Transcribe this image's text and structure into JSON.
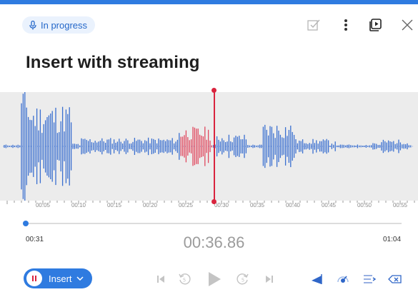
{
  "header": {
    "status_label": "In progress",
    "title": "Insert with streaming",
    "icons": [
      "mic-icon",
      "check-square-icon",
      "more-vertical-icon",
      "play-window-icon",
      "close-icon"
    ]
  },
  "timeline": {
    "tick_labels": [
      "00:05",
      "00:10",
      "00:15",
      "00:20",
      "00:25",
      "00:30",
      "00:35",
      "00:40",
      "00:45",
      "00:50",
      "00:55"
    ],
    "start_time": "00:31",
    "current_time": "00:36.86",
    "end_time": "01:04"
  },
  "controls": {
    "insert_label": "Insert",
    "icons": [
      "skip-back-icon",
      "rewind-icon",
      "play-icon",
      "forward-icon",
      "skip-forward-icon",
      "volume-icon",
      "speed-icon",
      "options-icon",
      "delete-icon"
    ]
  },
  "colors": {
    "accent": "#2f7be0",
    "playhead": "#d9243e",
    "wave": "#3a6fd0",
    "wave_highlight": "#e0485e"
  }
}
